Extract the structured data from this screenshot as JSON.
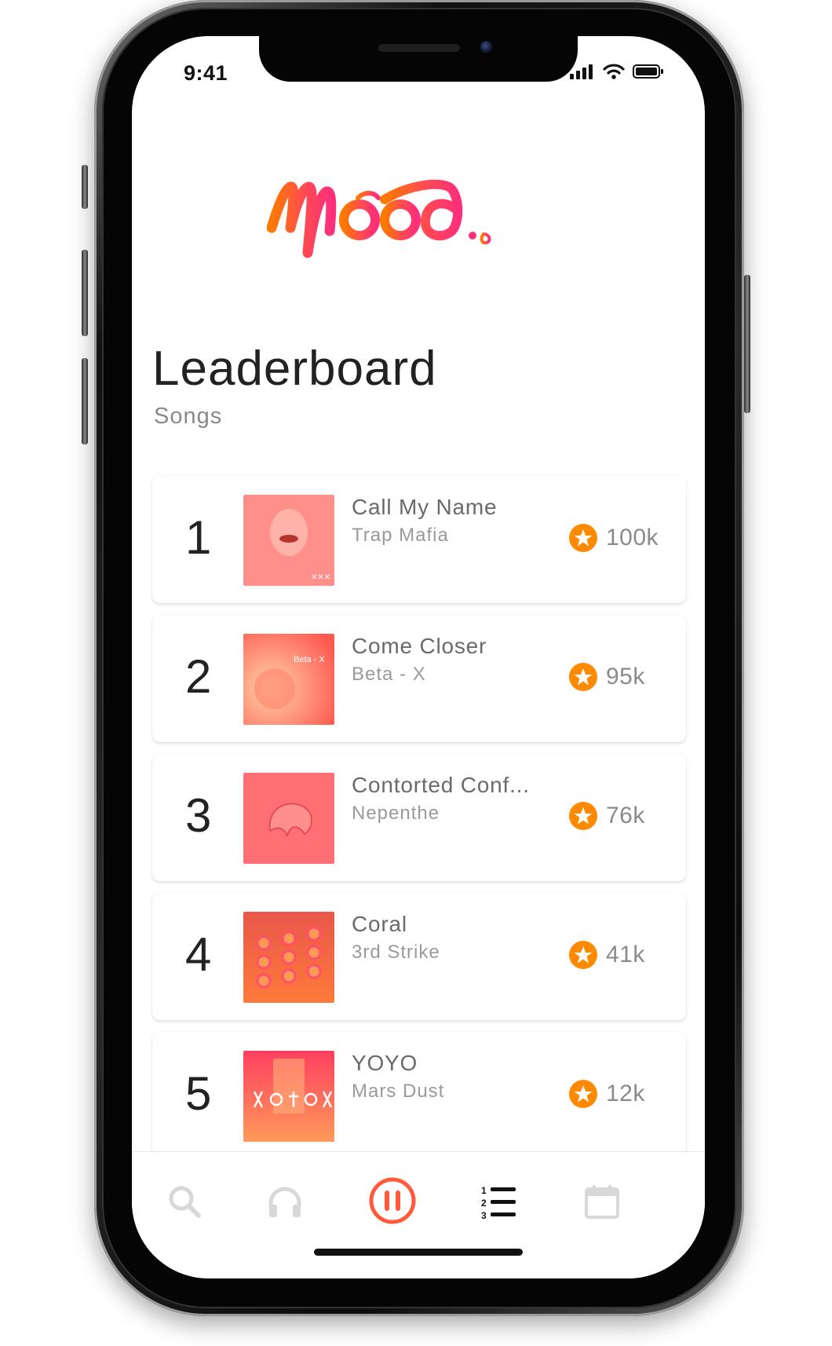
{
  "status_bar": {
    "time": "9:41",
    "icons": [
      "signal-icon",
      "wifi-icon",
      "battery-icon"
    ]
  },
  "app": {
    "logo_text": "Mood.",
    "brand_gradient": [
      "#ff7a00",
      "#ff2f7a"
    ]
  },
  "header": {
    "title": "Leaderboard",
    "subtitle": "Songs"
  },
  "leaderboard": [
    {
      "rank": "1",
      "song": "Call My Name",
      "artist": "Trap Mafia",
      "score": "100k",
      "icon": "star-badge-icon"
    },
    {
      "rank": "2",
      "song": "Come Closer",
      "artist": "Beta - X",
      "score": "95k",
      "icon": "star-badge-icon"
    },
    {
      "rank": "3",
      "song": "Contorted Conf...",
      "artist": "Nepenthe",
      "score": "76k",
      "icon": "star-badge-icon"
    },
    {
      "rank": "4",
      "song": "Coral",
      "artist": "3rd Strike",
      "score": "41k",
      "icon": "star-badge-icon"
    },
    {
      "rank": "5",
      "song": "YOYO",
      "artist": "Mars Dust",
      "score": "12k",
      "icon": "star-badge-icon"
    }
  ],
  "bottom_nav": {
    "items": [
      "search-icon",
      "headphones-icon",
      "pause-icon",
      "ranked-list-icon",
      "calendar-icon"
    ],
    "active": "pause-icon",
    "active_color": "#ff5a3c",
    "inactive_color": "#d8d8d8"
  },
  "colors": {
    "star_badge": "#ff8a00",
    "text_dark": "#222222",
    "text_muted": "#8a8a8a"
  }
}
